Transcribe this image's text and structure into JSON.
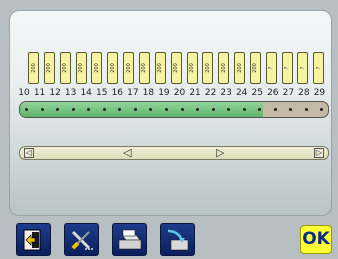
{
  "tags": [
    "200",
    "200",
    "200",
    "200",
    "200",
    "200",
    "200",
    "200",
    "200",
    "200",
    "200",
    "200",
    "200",
    "200",
    "200",
    "?",
    "?",
    "?",
    "?"
  ],
  "positions": [
    "10",
    "11",
    "12",
    "13",
    "14",
    "15",
    "16",
    "17",
    "18",
    "19",
    "20",
    "21",
    "22",
    "23",
    "24",
    "25",
    "26",
    "27",
    "28",
    "29"
  ],
  "track": {
    "filled_fraction": 0.79,
    "dot_count": 20
  },
  "scroll": {
    "left_arrow": "◁",
    "right_arrow": "▷",
    "thumb_left": "◁",
    "thumb_right": "▷"
  },
  "toolbar": {
    "buttons": [
      {
        "icon": "exit-door-icon"
      },
      {
        "icon": "tools-icon"
      },
      {
        "icon": "print-icon"
      },
      {
        "icon": "output-tray-icon"
      }
    ],
    "ok_label": "OK"
  },
  "colors": {
    "tag_fill": "#f7f3a0",
    "track_green": "#5fb36b",
    "track_tan": "#c3b9a4",
    "ok_fill": "#ffff33",
    "ok_text": "#0b2b8a"
  }
}
